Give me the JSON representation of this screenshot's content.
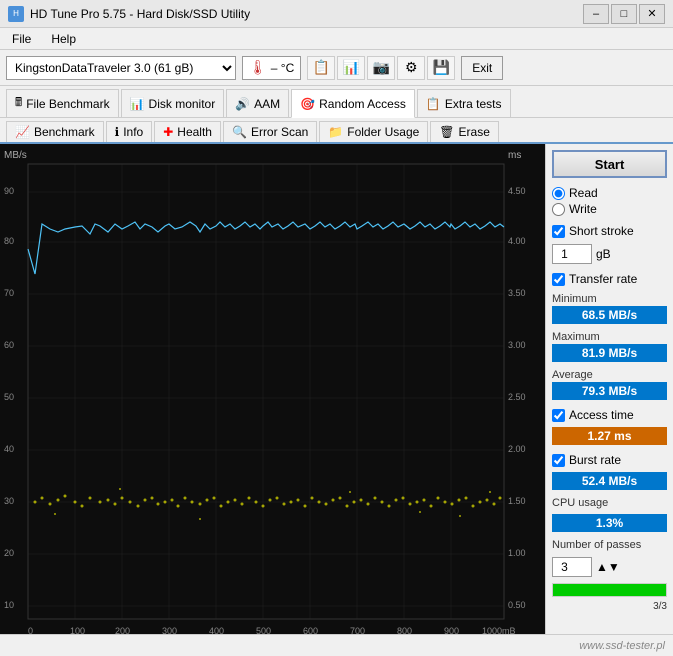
{
  "titleBar": {
    "title": "HD Tune Pro 5.75 - Hard Disk/SSD Utility",
    "minimizeBtn": "–",
    "maximizeBtn": "□",
    "closeBtn": "✕"
  },
  "menuBar": {
    "items": [
      "File",
      "Help"
    ]
  },
  "toolbar": {
    "deviceName": "KingstonDataTraveler 3.0 (61 gB)",
    "tempLabel": "– °C",
    "exitLabel": "Exit"
  },
  "tabs": {
    "row1": [
      {
        "label": "File Benchmark",
        "icon": "📄"
      },
      {
        "label": "Disk monitor",
        "icon": "📊"
      },
      {
        "label": "AAM",
        "icon": "🔊"
      },
      {
        "label": "Random Access",
        "icon": "🎲"
      },
      {
        "label": "Extra tests",
        "icon": "📋"
      }
    ],
    "row2": [
      {
        "label": "Benchmark",
        "icon": "📈"
      },
      {
        "label": "Info",
        "icon": "ℹ"
      },
      {
        "label": "Health",
        "icon": "❤"
      },
      {
        "label": "Error Scan",
        "icon": "🔍"
      },
      {
        "label": "Folder Usage",
        "icon": "📁"
      },
      {
        "label": "Erase",
        "icon": "🗑"
      }
    ]
  },
  "chart": {
    "yLeftLabel": "MB/s",
    "yRightLabel": "ms",
    "yLeftValues": [
      "90",
      "80",
      "70",
      "60",
      "50",
      "40",
      "30",
      "20",
      "10"
    ],
    "yRightValues": [
      "4.50",
      "4.00",
      "3.50",
      "3.00",
      "2.50",
      "2.00",
      "1.50",
      "1.00",
      "0.50"
    ],
    "xValues": [
      "0",
      "100",
      "200",
      "300",
      "400",
      "500",
      "600",
      "700",
      "800",
      "900"
    ],
    "xSuffix": "1000mB",
    "lineColor": "#4fc3f7",
    "dotColor": "#cccc00"
  },
  "rightPanel": {
    "startLabel": "Start",
    "radioRead": "Read",
    "radioWrite": "Write",
    "shortStroke": "Short stroke",
    "shortStrokeValue": "1",
    "shortStrokeUnit": "gB",
    "transferRate": "Transfer rate",
    "minimum": "Minimum",
    "minValue": "68.5 MB/s",
    "maximum": "Maximum",
    "maxValue": "81.9 MB/s",
    "average": "Average",
    "avgValue": "79.3 MB/s",
    "accessTime": "Access time",
    "accessValue": "1.27 ms",
    "burstRate": "Burst rate",
    "burstValue": "52.4 MB/s",
    "cpuUsage": "CPU usage",
    "cpuValue": "1.3%",
    "numPasses": "Number of passes",
    "passesValue": "3",
    "progressLabel": "3/3"
  },
  "statusBar": {
    "watermark": "www.ssd-tester.pl"
  }
}
